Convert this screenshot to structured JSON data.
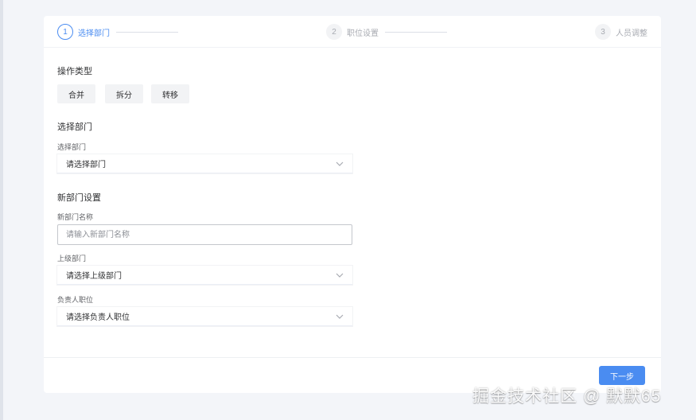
{
  "steps": [
    {
      "number": "1",
      "title": "选择部门",
      "state": "active"
    },
    {
      "number": "2",
      "title": "职位设置",
      "state": "inactive"
    },
    {
      "number": "3",
      "title": "人员调整",
      "state": "inactive"
    }
  ],
  "operation": {
    "title": "操作类型",
    "buttons": [
      "合并",
      "拆分",
      "转移"
    ]
  },
  "select_dept": {
    "title": "选择部门",
    "label": "选择部门",
    "value": "请选择部门"
  },
  "new_dept": {
    "title": "新部门设置",
    "name_label": "新部门名称",
    "name_placeholder": "请输入新部门名称",
    "parent_label": "上级部门",
    "parent_value": "请选择上级部门",
    "leader_label": "负责人职位",
    "leader_value": "请选择负责人职位"
  },
  "footer": {
    "next_label": "下一步"
  },
  "watermark": "掘金技术社区 @ 默默65",
  "colors": {
    "accent": "#4a8cf1",
    "background": "#f3f5f9",
    "inactive": "#a8abb2"
  }
}
